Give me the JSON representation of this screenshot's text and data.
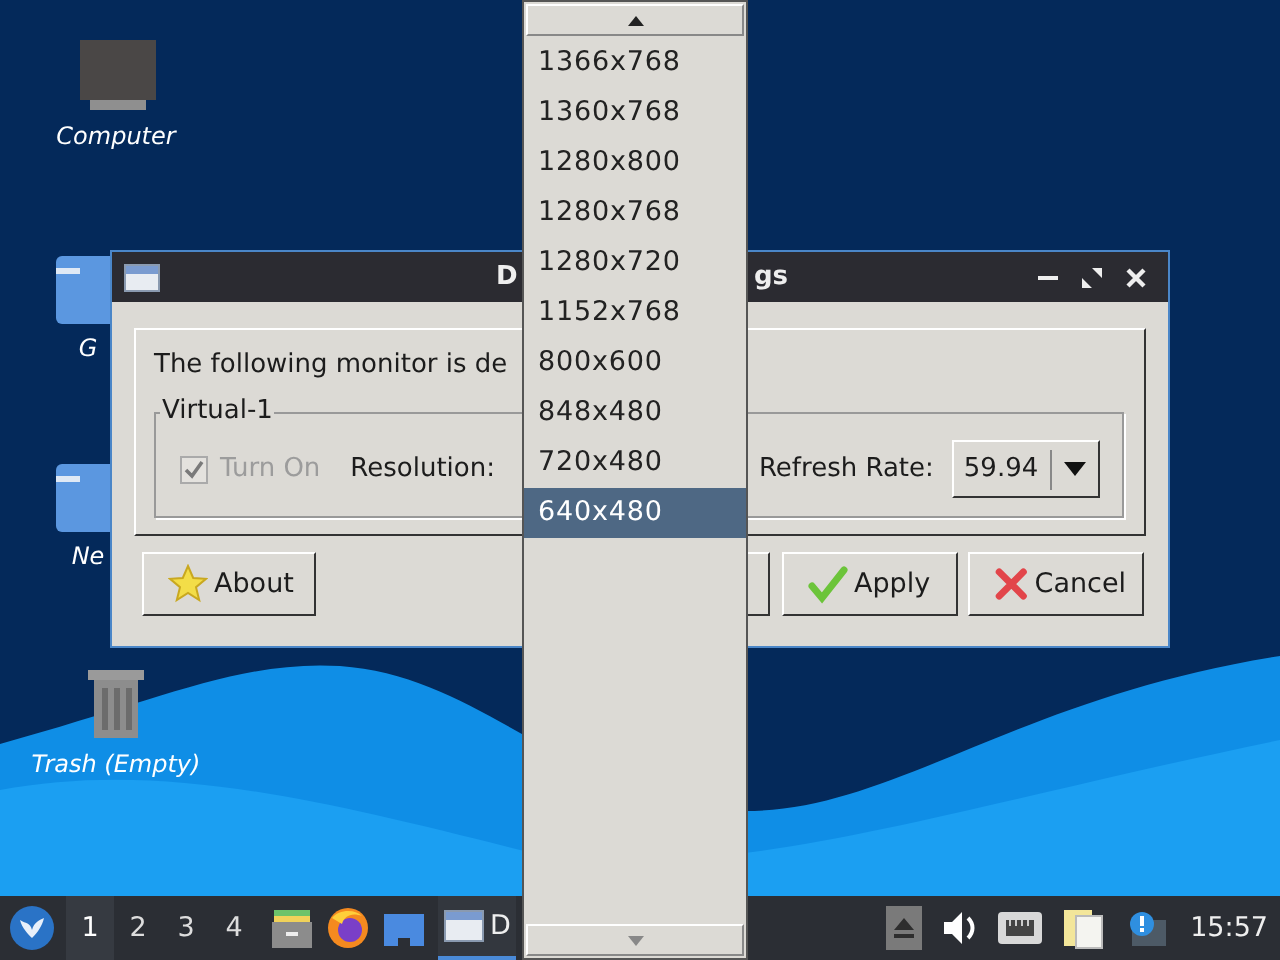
{
  "desktop": {
    "icons": [
      {
        "kind": "computer",
        "label": "Computer"
      },
      {
        "kind": "folder",
        "label": "G"
      },
      {
        "kind": "folder",
        "label": "Ne"
      },
      {
        "kind": "trash",
        "label": "Trash (Empty)"
      }
    ]
  },
  "dialog": {
    "title_left": "D",
    "title_right": "gs",
    "message": "The following monitor is de",
    "group_title": "Virtual-1",
    "turn_on": {
      "label": "Turn On",
      "checked": true,
      "disabled": true
    },
    "resolution_label": "Resolution:",
    "refresh_label": "Refresh Rate:",
    "refresh_value": "59.94",
    "buttons": [
      {
        "kind": "about",
        "label": "About"
      },
      {
        "kind": "covered"
      },
      {
        "kind": "apply",
        "label": "Apply"
      },
      {
        "kind": "cancel",
        "label": "Cancel"
      }
    ]
  },
  "dropdown": {
    "options": [
      {
        "label": "1366x768",
        "selected": false
      },
      {
        "label": "1360x768",
        "selected": false
      },
      {
        "label": "1280x800",
        "selected": false
      },
      {
        "label": "1280x768",
        "selected": false
      },
      {
        "label": "1280x720",
        "selected": false
      },
      {
        "label": "1152x768",
        "selected": false
      },
      {
        "label": "800x600",
        "selected": false
      },
      {
        "label": "848x480",
        "selected": false
      },
      {
        "label": "720x480",
        "selected": false
      },
      {
        "label": "640x480",
        "selected": true
      }
    ]
  },
  "taskbar": {
    "workspaces": [
      {
        "label": "1",
        "selected": true
      },
      {
        "label": "2",
        "selected": false
      },
      {
        "label": "3",
        "selected": false
      },
      {
        "label": "4",
        "selected": false
      }
    ],
    "launchers": [
      {
        "kind": "files"
      },
      {
        "kind": "browser"
      },
      {
        "kind": "folder"
      }
    ],
    "window_button": {
      "label": "D",
      "active": true
    },
    "tray": [
      {
        "kind": "eject"
      },
      {
        "kind": "volume"
      },
      {
        "kind": "network"
      },
      {
        "kind": "notes"
      },
      {
        "kind": "info"
      }
    ],
    "clock": "15:57"
  }
}
